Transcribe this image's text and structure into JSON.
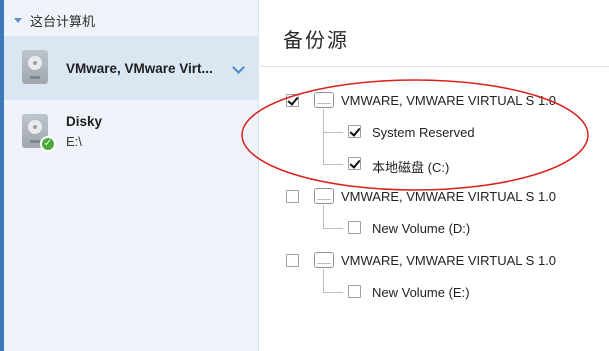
{
  "left_pane": {
    "tree_header": "这台计算机",
    "drives": [
      {
        "name": "VMware, VMware Virt...",
        "selected": true,
        "expanded_chevron": "chevron-down-icon"
      },
      {
        "name": "Disky",
        "sub": "E:\\",
        "status": "ok"
      }
    ]
  },
  "right_pane": {
    "title": "备份源",
    "disks": [
      {
        "name": "VMWARE, VMWARE VIRTUAL S 1.0",
        "checked": true,
        "partitions": [
          {
            "name": "System Reserved",
            "checked": true
          },
          {
            "name": "本地磁盘 (C:)",
            "checked": true
          }
        ]
      },
      {
        "name": "VMWARE, VMWARE VIRTUAL S 1.0",
        "checked": false,
        "partitions": [
          {
            "name": "New Volume (D:)",
            "checked": false
          }
        ]
      },
      {
        "name": "VMWARE, VMWARE VIRTUAL S 1.0",
        "checked": false,
        "partitions": [
          {
            "name": "New Volume (E:)",
            "checked": false
          }
        ]
      }
    ]
  },
  "colors": {
    "accent": "#3c79b8",
    "selected_row": "#dbe6f3",
    "annotation_ellipse": "#d9221c",
    "status_ok": "#4caa3a"
  }
}
